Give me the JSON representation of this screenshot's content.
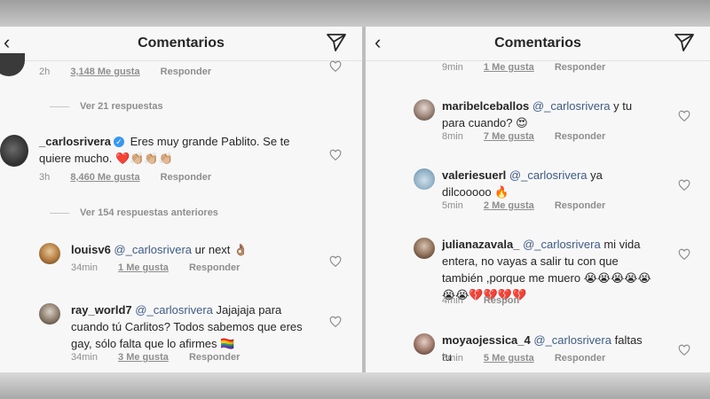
{
  "left": {
    "title": "Comentarios",
    "top_meta": {
      "time": "2h",
      "likes": "3,148 Me gusta",
      "reply": "Responder"
    },
    "view_replies_1": "Ver 21 respuestas",
    "main_comment": {
      "user": "_carlosrivera",
      "text": "Eres muy grande Pablito. Se te quiere mucho. ❤️👏🏼👏🏼👏🏼",
      "time": "3h",
      "likes": "8,460 Me gusta",
      "reply": "Responder"
    },
    "view_replies_2": "Ver 154 respuestas anteriores",
    "replies": [
      {
        "user": "louisv6",
        "mention": "@_carlosrivera",
        "text": "ur next 👌🏽",
        "time": "34min",
        "likes": "1 Me gusta",
        "reply": "Responder"
      },
      {
        "user": "ray_world7",
        "mention": "@_carlosrivera",
        "text": "Jajajaja para cuando tú Carlitos? Todos sabemos que eres gay, sólo falta que lo afirmes 🏳️‍🌈",
        "time": "34min",
        "likes": "3 Me gusta",
        "reply": "Responder"
      }
    ]
  },
  "right": {
    "title": "Comentarios",
    "top_meta": {
      "time": "9min",
      "likes": "1 Me gusta",
      "reply": "Responder"
    },
    "replies": [
      {
        "user": "maribelceballos",
        "mention": "@_carlosrivera",
        "text": "y tu para cuando? 😍",
        "time": "8min",
        "likes": "7 Me gusta",
        "reply": "Responder"
      },
      {
        "user": "valeriesuerl",
        "mention": "@_carlosrivera",
        "text": "ya dilcooooo 🔥",
        "time": "5min",
        "likes": "2 Me gusta",
        "reply": "Responder"
      },
      {
        "user": "julianazavala_",
        "mention": "@_carlosrivera",
        "text": "mi vida entera, no vayas a salir tu con que también ,porque me muero 😭😭😭😭😭😭😭💔💔💔💔",
        "time": "4min",
        "likes": "",
        "reply": "Respon"
      },
      {
        "user": "moyaojessica_4",
        "mention": "@_carlosrivera",
        "text": "faltas tu",
        "time": "5min",
        "likes": "5 Me gusta",
        "reply": "Responder"
      }
    ]
  }
}
